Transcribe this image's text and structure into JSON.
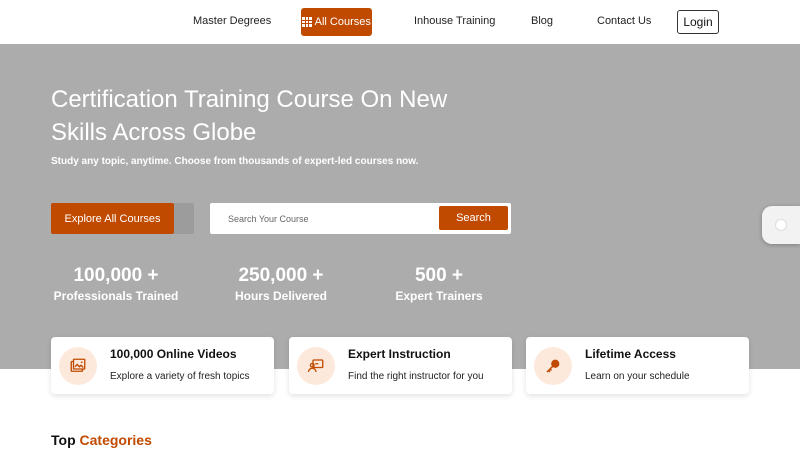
{
  "nav": {
    "items": [
      "Master Degrees",
      "All Courses",
      "Inhouse Training",
      "Blog",
      "Contact Us"
    ],
    "login": "Login"
  },
  "hero": {
    "title": "Certification Training Course On New Skills Across Globe",
    "subtitle": "Study any topic, anytime. Choose from thousands of expert-led courses now.",
    "explore_button": "Explore All Courses",
    "search_placeholder": "Search Your Course",
    "search_button": "Search"
  },
  "stats": [
    {
      "value": "100,000 +",
      "label": "Professionals Trained"
    },
    {
      "value": "250,000 +",
      "label": "Hours Delivered"
    },
    {
      "value": "500 +",
      "label": "Expert Trainers"
    }
  ],
  "features": [
    {
      "title": "100,000 Online Videos",
      "desc": "Explore a variety of fresh topics",
      "icon": "video-gallery-icon"
    },
    {
      "title": "Expert Instruction",
      "desc": "Find the right instructor for you",
      "icon": "instructor-icon"
    },
    {
      "title": "Lifetime Access",
      "desc": "Learn on your schedule",
      "icon": "key-icon"
    }
  ],
  "categories": {
    "heading_prefix": "Top",
    "heading_accent": "Categories"
  },
  "colors": {
    "accent": "#c04a00",
    "hero_bg": "#acacac"
  }
}
